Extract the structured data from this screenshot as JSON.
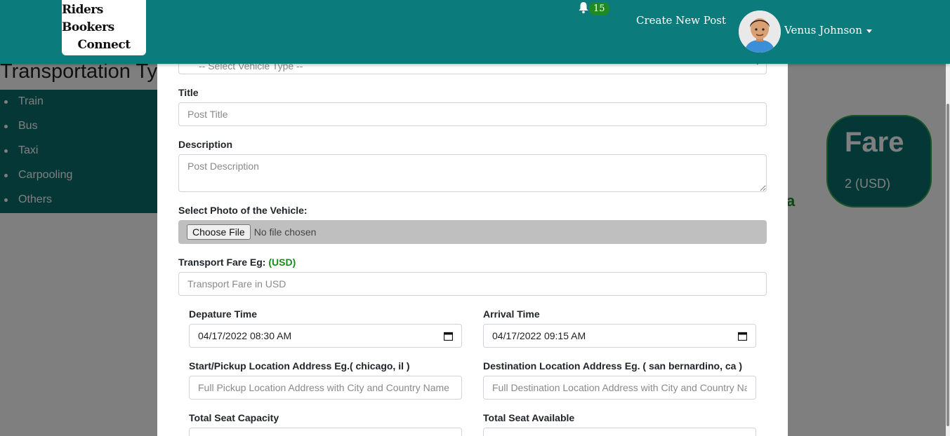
{
  "brand": {
    "line1": "Riders Bookers",
    "line2": "Connect"
  },
  "navbar": {
    "notification_count": "15",
    "create_post_label": "Create New Post",
    "user_name": "Venus Johnson"
  },
  "background": {
    "heading": "Transportation Ty",
    "transport_types": [
      "Train",
      "Bus",
      "Taxi",
      "Carpooling",
      "Others"
    ],
    "fare_card": {
      "title": "Fare",
      "value": "2 (USD)"
    },
    "partial_char": "a"
  },
  "modal": {
    "vehicle_type_select": {
      "placeholder": "-- Select Vehicle Type --"
    },
    "title": {
      "label": "Title",
      "placeholder": "Post Title"
    },
    "description": {
      "label": "Description",
      "placeholder": "Post Description"
    },
    "photo": {
      "label": "Select Photo of the Vehicle:",
      "button": "Choose File",
      "status": "No file chosen"
    },
    "fare": {
      "label": "Transport Fare Eg:",
      "unit": "(USD)",
      "placeholder": "Transport Fare in USD"
    },
    "departure": {
      "label": "Depature Time",
      "value": "04/17/2022 08:30 AM"
    },
    "arrival": {
      "label": "Arrival Time",
      "value": "04/17/2022 09:15 AM"
    },
    "pickup": {
      "label": "Start/Pickup Location Address Eg.( chicago, il )",
      "placeholder": "Full Pickup Location Address with City and Country Name"
    },
    "destination": {
      "label": "Destination Location Address Eg. ( san bernardino, ca )",
      "placeholder": "Full Destination Location Address with City and Country Name"
    },
    "seat_capacity": {
      "label": "Total Seat Capacity"
    },
    "seat_available": {
      "label": "Total Seat Available"
    }
  },
  "colors": {
    "navbar": "#0b7b7b",
    "accent_green": "#1f8a1f",
    "file_box": "#bfbfbf"
  }
}
